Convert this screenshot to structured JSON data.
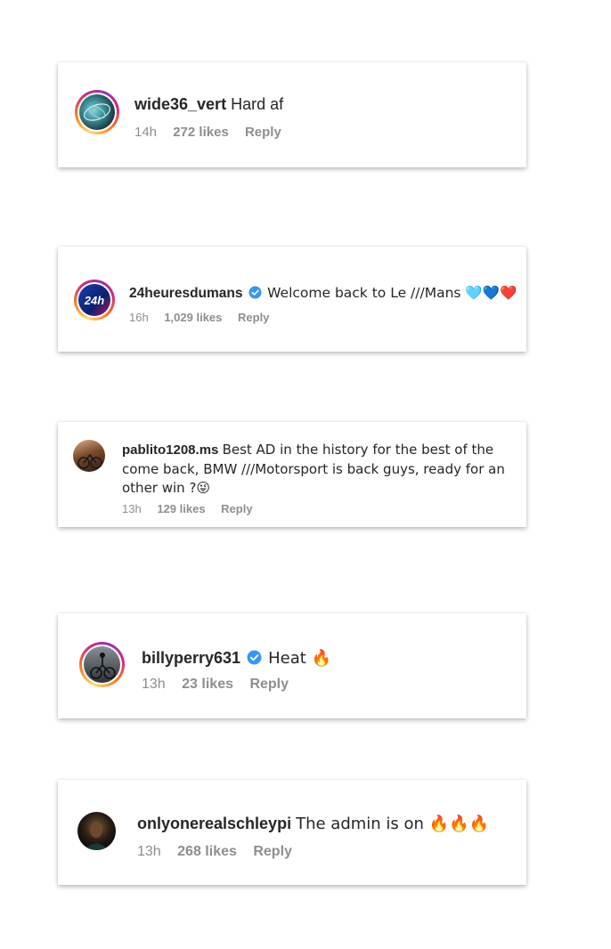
{
  "comments": [
    {
      "username": "wide36_vert",
      "verified": false,
      "text": "Hard af",
      "time": "14h",
      "likes": "272 likes",
      "reply": "Reply"
    },
    {
      "username": "24heuresdumans",
      "verified": true,
      "text": "Welcome back to Le ///Mans 🩵💙❤️",
      "time": "16h",
      "likes": "1,029 likes",
      "reply": "Reply",
      "avatar_label": "24h"
    },
    {
      "username": "pablito1208.ms",
      "verified": false,
      "text": "Best AD in the history for the best of the come back, BMW ///Motorsport is back guys, ready for an other win ?😜",
      "time": "13h",
      "likes": "129 likes",
      "reply": "Reply"
    },
    {
      "username": "billyperry631",
      "verified": true,
      "text": "Heat 🔥",
      "time": "13h",
      "likes": "23 likes",
      "reply": "Reply"
    },
    {
      "username": "onlyonerealschleypi",
      "verified": false,
      "text": "The admin is on 🔥🔥🔥",
      "time": "13h",
      "likes": "268 likes",
      "reply": "Reply"
    }
  ],
  "colors": {
    "verified": "#3897f0",
    "meta": "#8e8e8e",
    "text": "#262626"
  },
  "icons": {
    "verified": "verified-badge-icon"
  }
}
